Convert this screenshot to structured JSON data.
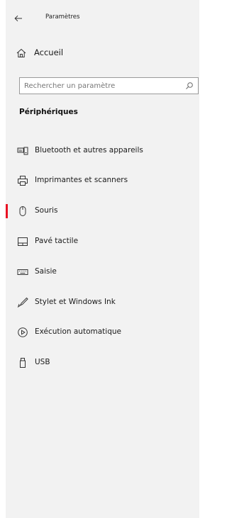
{
  "header": {
    "back_icon": "back-arrow-icon",
    "title": "Paramètres"
  },
  "home": {
    "icon": "home-icon",
    "label": "Accueil"
  },
  "search": {
    "placeholder": "Rechercher un paramètre",
    "value": "",
    "icon": "search-icon"
  },
  "section": {
    "title": "Périphériques"
  },
  "nav": {
    "items": [
      {
        "label": "Bluetooth et autres appareils",
        "icon": "bluetooth-devices-icon",
        "selected": false
      },
      {
        "label": "Imprimantes et scanners",
        "icon": "printer-icon",
        "selected": false
      },
      {
        "label": "Souris",
        "icon": "mouse-icon",
        "selected": true
      },
      {
        "label": "Pavé tactile",
        "icon": "touchpad-icon",
        "selected": false
      },
      {
        "label": "Saisie",
        "icon": "keyboard-icon",
        "selected": false
      },
      {
        "label": "Stylet et Windows Ink",
        "icon": "pen-icon",
        "selected": false
      },
      {
        "label": "Exécution automatique",
        "icon": "autoplay-icon",
        "selected": false
      },
      {
        "label": "USB",
        "icon": "usb-icon",
        "selected": false
      }
    ]
  },
  "colors": {
    "pane_bg": "#f2f2f2",
    "accent": "#e81123",
    "text": "#1a1a1a"
  }
}
